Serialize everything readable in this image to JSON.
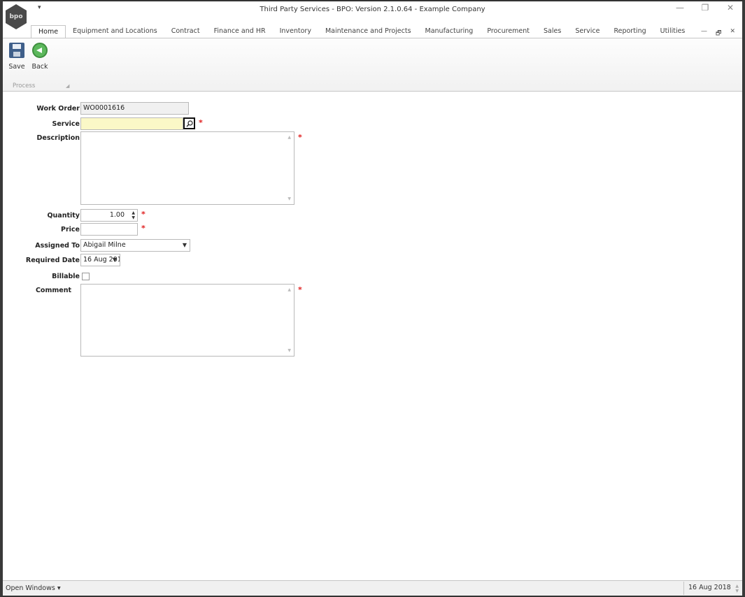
{
  "window": {
    "title": "Third Party Services - BPO: Version 2.1.0.64 - Example Company",
    "logo_text": "bpo",
    "qat_glyph": "▾",
    "controls": {
      "minimize": "—",
      "restore": "❐",
      "close": "✕"
    },
    "mdi_controls": {
      "minimize": "—",
      "restore": "🗗",
      "close": "✕"
    }
  },
  "tabs": [
    "Home",
    "Equipment and Locations",
    "Contract",
    "Finance and HR",
    "Inventory",
    "Maintenance and Projects",
    "Manufacturing",
    "Procurement",
    "Sales",
    "Service",
    "Reporting",
    "Utilities"
  ],
  "ribbon": {
    "save_label": "Save",
    "back_label": "Back",
    "group_label": "Process",
    "group_launcher": "◢"
  },
  "form": {
    "work_order": {
      "label": "Work Order",
      "value": "WO0001616"
    },
    "service": {
      "label": "Service",
      "value": ""
    },
    "description": {
      "label": "Description",
      "value": ""
    },
    "quantity": {
      "label": "Quantity",
      "value": "1.00"
    },
    "price": {
      "label": "Price",
      "value": ""
    },
    "assigned_to": {
      "label": "Assigned To",
      "value": "Abigail Milne"
    },
    "required_date": {
      "label": "Required Date",
      "value": "16 Aug 2018"
    },
    "billable": {
      "label": "Billable",
      "checked": false
    },
    "comment": {
      "label": "Comment",
      "value": ""
    },
    "required_marker": "*"
  },
  "statusbar": {
    "open_windows": "Open Windows ▾",
    "date": "16 Aug 2018"
  },
  "colors": {
    "required": "#e02020",
    "highlight_field": "#fbf8c7",
    "readonly_field": "#f0f0f0"
  }
}
